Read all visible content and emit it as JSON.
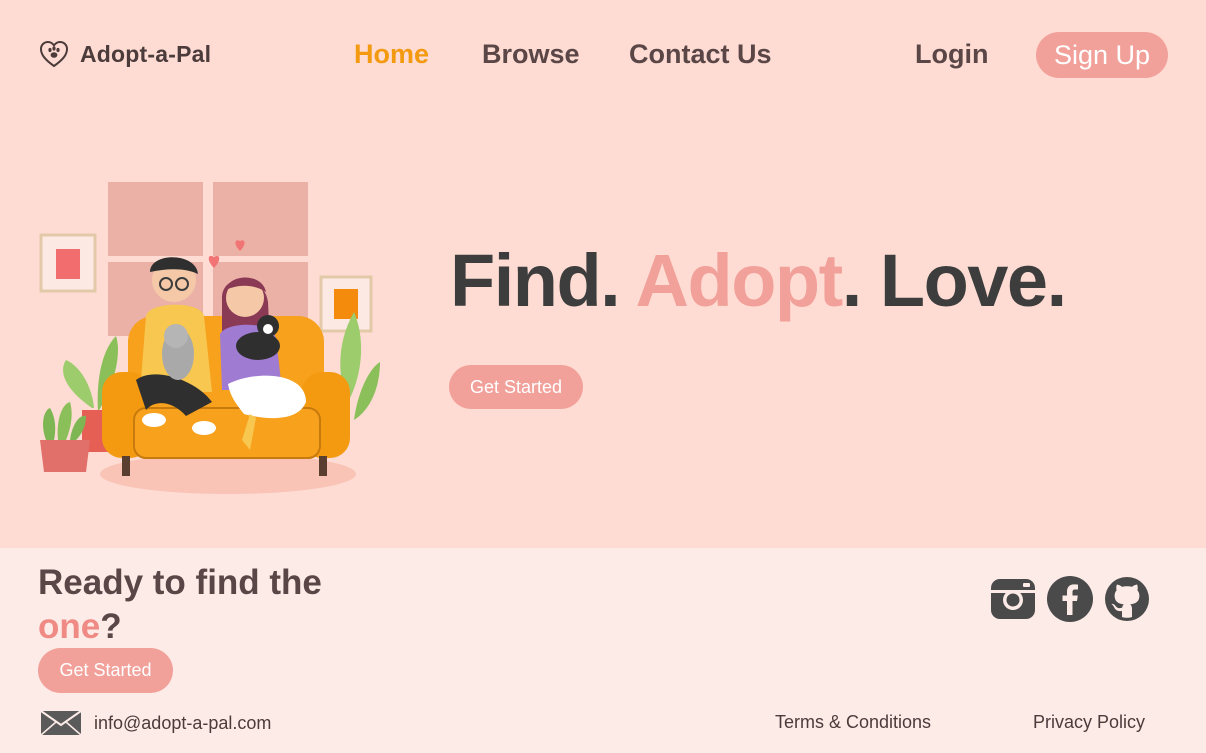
{
  "brand": {
    "name": "Adopt-a-Pal",
    "icon": "heart-paw-icon"
  },
  "nav": {
    "links": [
      {
        "label": "Home",
        "active": true
      },
      {
        "label": "Browse",
        "active": false
      },
      {
        "label": "Contact Us",
        "active": false
      }
    ],
    "login_label": "Login",
    "signup_label": "Sign Up"
  },
  "hero": {
    "title_part1": "Find. ",
    "title_accent": "Adopt",
    "title_part2": ". Love.",
    "cta_label": "Get Started",
    "illustration": "couple-with-cats-on-sofa-illustration"
  },
  "footer": {
    "heading_part1": "Ready to find the ",
    "heading_accent": "one",
    "heading_part2": "?",
    "cta_label": "Get Started",
    "socials": [
      "instagram-icon",
      "facebook-icon",
      "github-icon"
    ],
    "email": "info@adopt-a-pal.com",
    "terms_label": "Terms & Conditions",
    "privacy_label": "Privacy Policy"
  },
  "colors": {
    "page_bg": "#fedcd3",
    "footer_bg": "#fdebe7",
    "accent_pink": "#f2a09a",
    "active_nav": "#f39a10",
    "dark_text": "#3d3d3d"
  }
}
